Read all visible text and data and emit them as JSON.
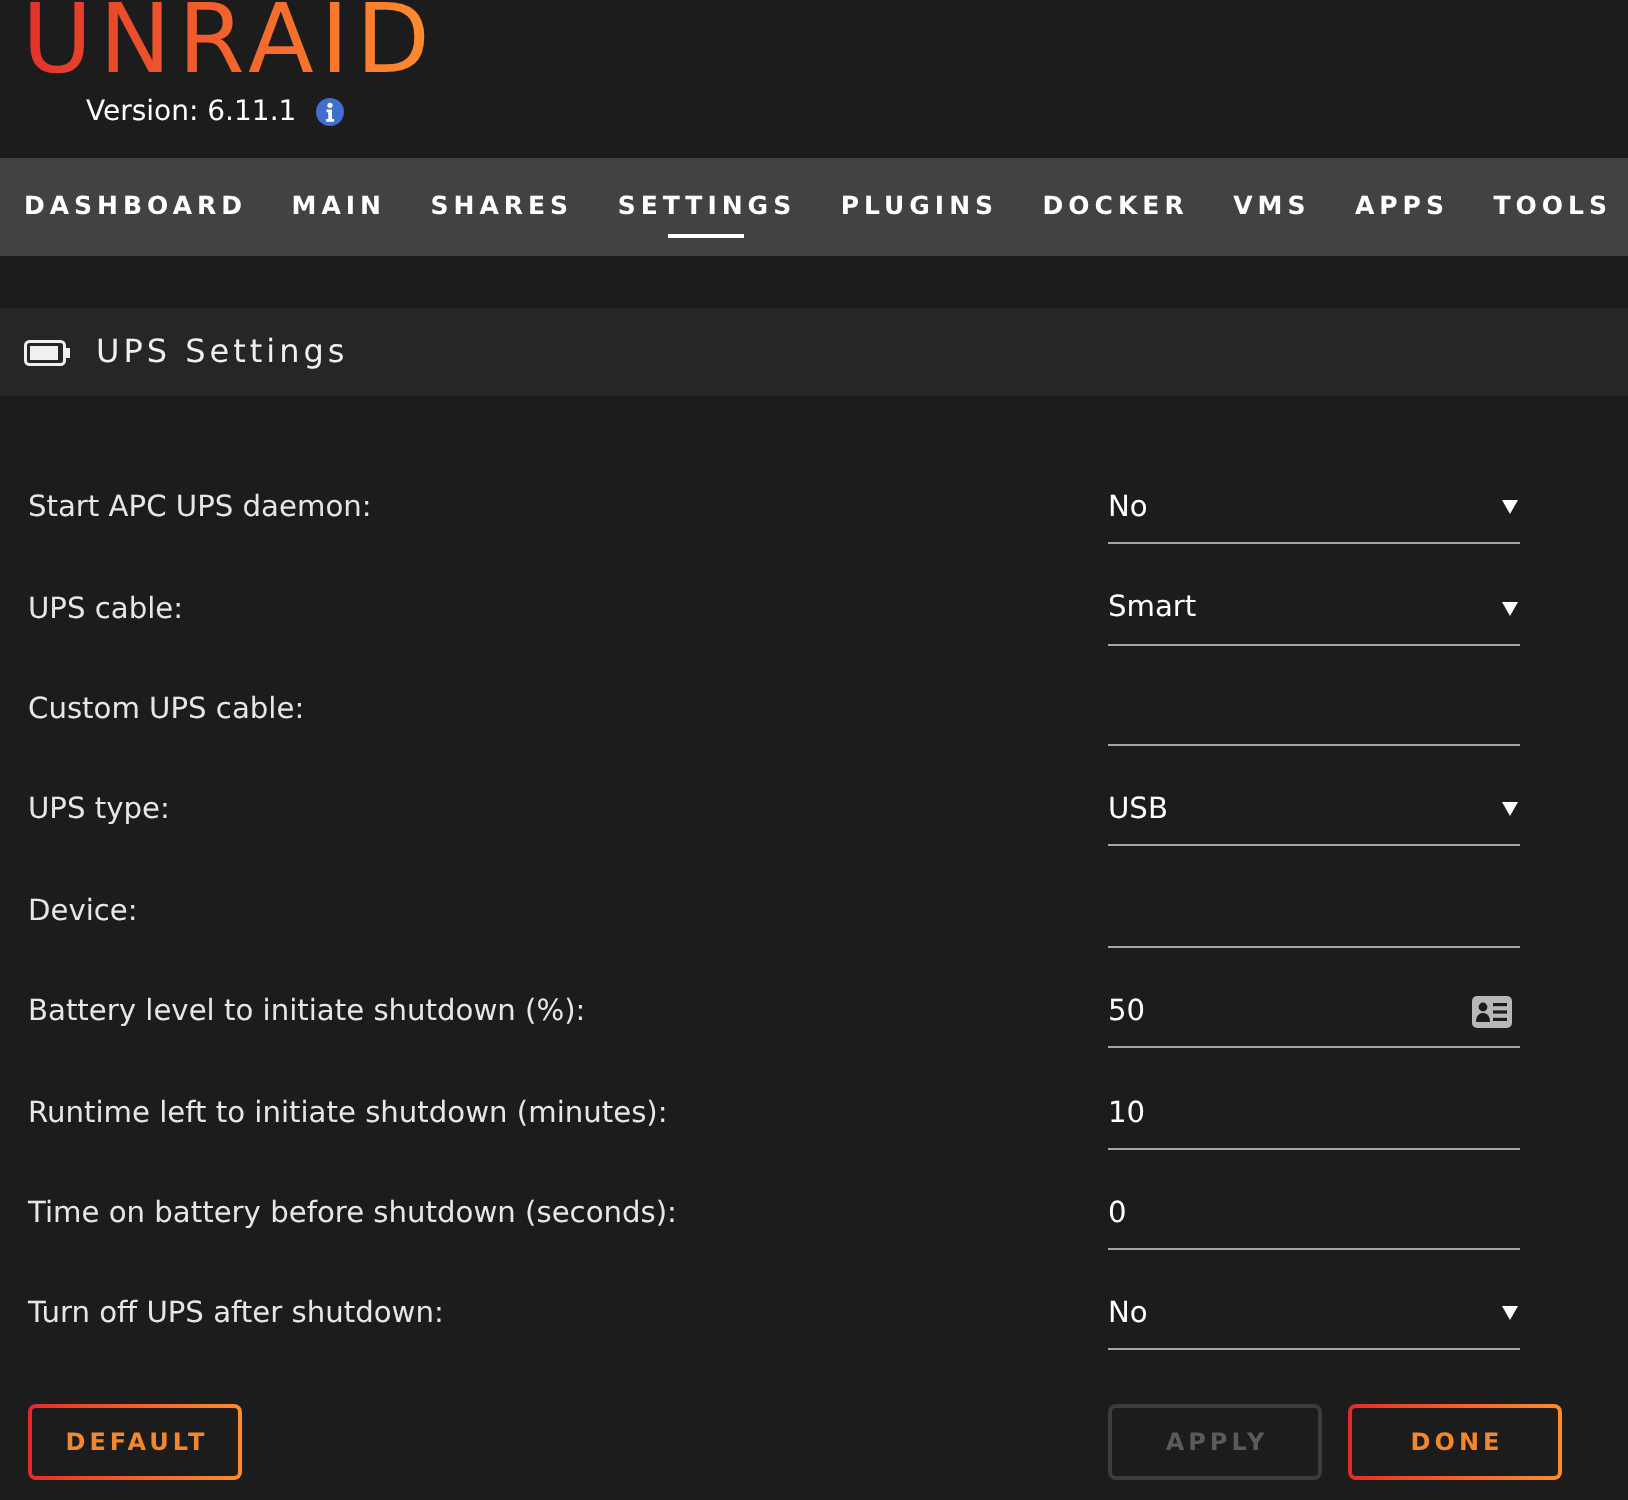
{
  "header": {
    "logo": "UNRAID",
    "version": "Version: 6.11.1"
  },
  "nav": [
    {
      "label": "DASHBOARD",
      "selected": false
    },
    {
      "label": "MAIN",
      "selected": false
    },
    {
      "label": "SHARES",
      "selected": false
    },
    {
      "label": "SETTINGS",
      "selected": true
    },
    {
      "label": "PLUGINS",
      "selected": false
    },
    {
      "label": "DOCKER",
      "selected": false
    },
    {
      "label": "VMS",
      "selected": false
    },
    {
      "label": "APPS",
      "selected": false
    },
    {
      "label": "TOOLS",
      "selected": false
    }
  ],
  "section": {
    "title": "UPS Settings"
  },
  "fields": [
    {
      "label": "Start APC UPS daemon:",
      "kind": "select",
      "value": "No"
    },
    {
      "label": "UPS cable:",
      "kind": "select",
      "value": "Smart"
    },
    {
      "label": "Custom UPS cable:",
      "kind": "text",
      "autofill": false
    },
    {
      "label": "UPS type:",
      "kind": "select",
      "value": "USB"
    },
    {
      "label": "Device:",
      "kind": "text",
      "autofill": false
    },
    {
      "label": "Battery level to initiate shutdown (%):",
      "kind": "text",
      "value": "50",
      "autofill": true
    },
    {
      "label": "Runtime left to initiate shutdown (minutes):",
      "kind": "text",
      "value": "10",
      "autofill": false
    },
    {
      "label": "Time on battery before shutdown (seconds):",
      "kind": "text",
      "value": "0",
      "autofill": false
    },
    {
      "label": "Turn off UPS after shutdown:",
      "kind": "select",
      "value": "No"
    }
  ],
  "actions": {
    "left": [
      {
        "label": "DEFAULT",
        "disabled": false
      }
    ],
    "right": [
      {
        "label": "APPLY",
        "disabled": true
      },
      {
        "label": "DONE",
        "disabled": false
      }
    ]
  }
}
